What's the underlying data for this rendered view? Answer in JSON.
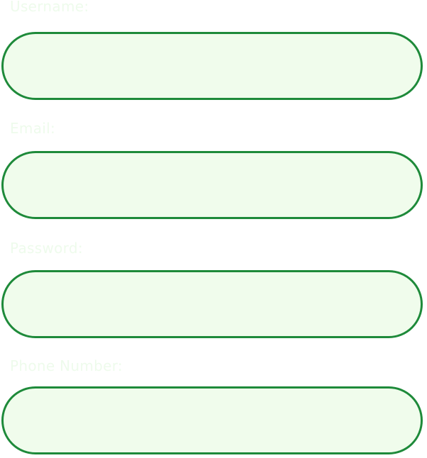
{
  "form": {
    "fields": [
      {
        "label": "Username:",
        "value": "",
        "placeholder": ""
      },
      {
        "label": "Email:",
        "value": "",
        "placeholder": ""
      },
      {
        "label": "Password:",
        "value": "",
        "placeholder": ""
      },
      {
        "label": "Phone Number:",
        "value": "",
        "placeholder": ""
      }
    ]
  },
  "colors": {
    "field_border": "#1e8a3a",
    "field_background": "#f0fcec",
    "label_text": "#eefbec"
  }
}
